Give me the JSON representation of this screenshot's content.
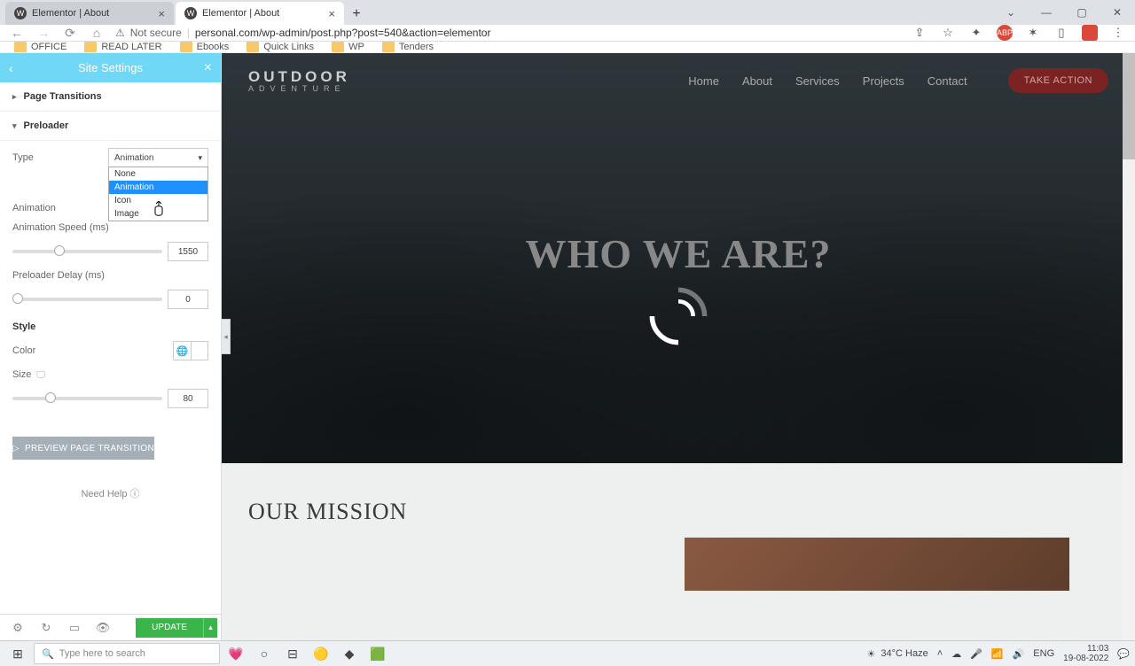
{
  "browser": {
    "tabs": [
      {
        "title": "Elementor | About",
        "active": false
      },
      {
        "title": "Elementor | About",
        "active": true
      }
    ],
    "url_insecure": "Not secure",
    "url": "personal.com/wp-admin/post.php?post=540&action=elementor",
    "bookmarks": [
      "OFFICE",
      "READ LATER",
      "Ebooks",
      "Quick Links",
      "WP",
      "Tenders"
    ],
    "ext_abp": "ABP"
  },
  "panel": {
    "title": "Site Settings",
    "sections": {
      "page_transitions": "Page Transitions",
      "preloader": "Preloader"
    },
    "controls": {
      "type_label": "Type",
      "type_value": "Animation",
      "type_options": [
        "None",
        "Animation",
        "Icon",
        "Image"
      ],
      "animation_label": "Animation",
      "speed_label": "Animation Speed (ms)",
      "speed_value": "1550",
      "delay_label": "Preloader Delay (ms)",
      "delay_value": "0",
      "style_heading": "Style",
      "color_label": "Color",
      "size_label": "Size",
      "size_value": "80"
    },
    "preview_btn": "PREVIEW PAGE TRANSITION",
    "help": "Need Help",
    "update": "UPDATE"
  },
  "site": {
    "logo": "OUTDOOR",
    "logo_sub": "ADVENTURE",
    "nav": [
      "Home",
      "About",
      "Services",
      "Projects",
      "Contact"
    ],
    "cta": "TAKE ACTION",
    "hero_title": "WHO WE ARE?",
    "mission": "OUR MISSION"
  },
  "taskbar": {
    "search_placeholder": "Type here to search",
    "weather": "34°C Haze",
    "lang": "ENG",
    "time": "11:03",
    "date": "19-08-2022"
  }
}
